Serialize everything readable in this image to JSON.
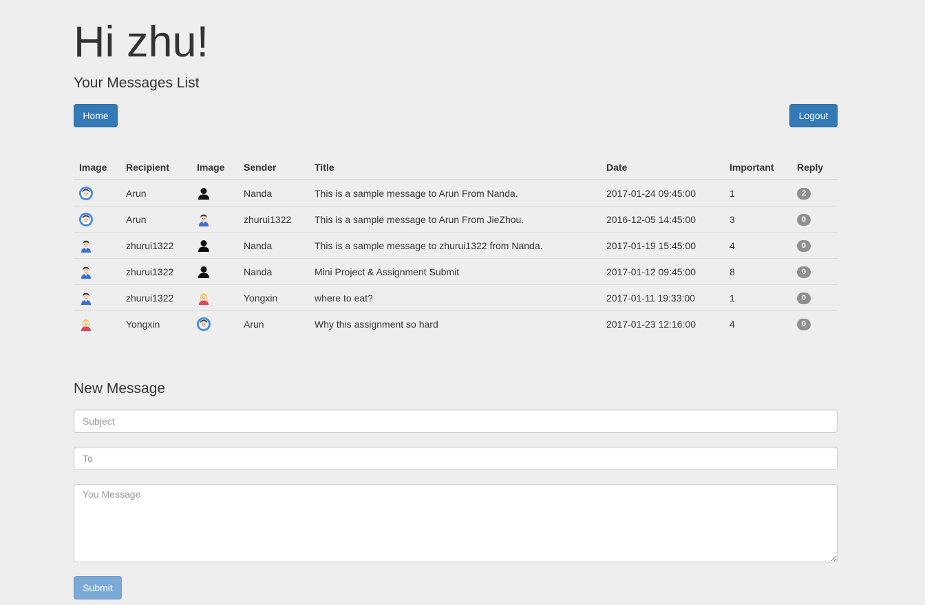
{
  "header": {
    "greeting": "Hi zhu!",
    "subtitle": "Your Messages List"
  },
  "nav": {
    "home_label": "Home",
    "logout_label": "Logout"
  },
  "table": {
    "columns": [
      "Image",
      "Recipient",
      "Image",
      "Sender",
      "Title",
      "Date",
      "Important",
      "Reply"
    ],
    "rows": [
      {
        "recipient_avatar": "globe-avatar-icon",
        "recipient": "Arun",
        "sender_avatar": "silhouette-avatar-icon",
        "sender": "Nanda",
        "title": "This is a sample message to Arun From Nanda.",
        "date": "2017-01-24 09:45:00",
        "important": "1",
        "reply": "2"
      },
      {
        "recipient_avatar": "globe-avatar-icon",
        "recipient": "Arun",
        "sender_avatar": "man-avatar-icon",
        "sender": "zhurui1322",
        "title": "This is a sample message to Arun From JieZhou.",
        "date": "2016-12-05 14:45:00",
        "important": "3",
        "reply": "0"
      },
      {
        "recipient_avatar": "man-avatar-icon",
        "recipient": "zhurui1322",
        "sender_avatar": "silhouette-avatar-icon",
        "sender": "Nanda",
        "title": "This is a sample message to zhurui1322 from Nanda.",
        "date": "2017-01-19 15:45:00",
        "important": "4",
        "reply": "0"
      },
      {
        "recipient_avatar": "man-avatar-icon",
        "recipient": "zhurui1322",
        "sender_avatar": "silhouette-avatar-icon",
        "sender": "Nanda",
        "title": "Mini Project & Assignment Submit",
        "date": "2017-01-12 09:45:00",
        "important": "8",
        "reply": "0"
      },
      {
        "recipient_avatar": "man-avatar-icon",
        "recipient": "zhurui1322",
        "sender_avatar": "woman-avatar-icon",
        "sender": "Yongxin",
        "title": "where to eat?",
        "date": "2017-01-11 19:33:00",
        "important": "1",
        "reply": "0"
      },
      {
        "recipient_avatar": "woman-avatar-icon",
        "recipient": "Yongxin",
        "sender_avatar": "globe-avatar-icon",
        "sender": "Arun",
        "title": "Why this assignment so hard",
        "date": "2017-01-23 12:16:00",
        "important": "4",
        "reply": "0"
      }
    ]
  },
  "new_message": {
    "heading": "New Message",
    "subject_placeholder": "Subject",
    "to_placeholder": "To",
    "message_placeholder": "You Message",
    "subject_value": "",
    "to_value": "",
    "message_value": "",
    "submit_label": "Submit"
  },
  "colors": {
    "background": "#eeeeee",
    "primary": "#337ab7",
    "submit_disabled": "#7aa9d6",
    "badge": "#8f8f8f"
  }
}
